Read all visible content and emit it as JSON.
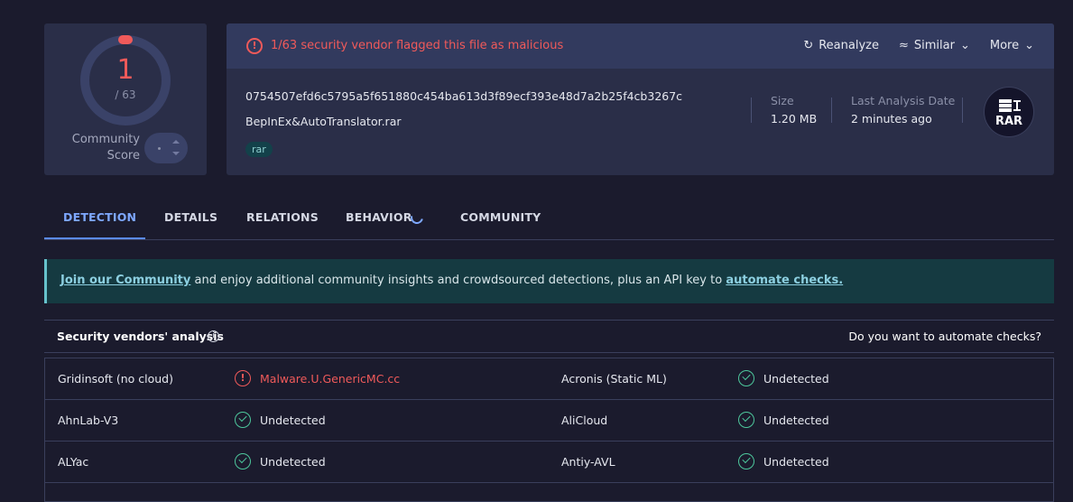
{
  "score": {
    "detections": "1",
    "total": "/ 63",
    "community_label_line1": "Community",
    "community_label_line2": "Score"
  },
  "file": {
    "alert": "1/63 security vendor flagged this file as malicious",
    "actions": {
      "reanalyze": "Reanalyze",
      "similar": "Similar",
      "more": "More"
    },
    "hash": "0754507efd6c5795a5f651880c454ba613d3f89ecf393e48d7a2b25f4cb3267c",
    "name": "BepInEx&AutoTranslator.rar",
    "tag": "rar",
    "size_label": "Size",
    "size_value": "1.20 MB",
    "last_label": "Last Analysis Date",
    "last_value": "2 minutes ago",
    "type_badge": "RAR"
  },
  "tabs": [
    {
      "label": "DETECTION"
    },
    {
      "label": "DETAILS"
    },
    {
      "label": "RELATIONS"
    },
    {
      "label": "BEHAVIOR"
    },
    {
      "label": "COMMUNITY"
    }
  ],
  "banner": {
    "link1": "Join our Community",
    "middle": " and enjoy additional community insights and crowdsourced detections, plus an API key to ",
    "link2": "automate checks."
  },
  "vendors": {
    "title": "Security vendors' analysis",
    "automate": "Do you want to automate checks?",
    "rows": [
      {
        "left_name": "Gridinsoft (no cloud)",
        "left_result": "Malware.U.GenericMC.cc",
        "right_name": "Acronis (Static ML)",
        "right_result": "Undetected"
      },
      {
        "left_name": "AhnLab-V3",
        "left_result": "Undetected",
        "right_name": "AliCloud",
        "right_result": "Undetected"
      },
      {
        "left_name": "ALYac",
        "left_result": "Undetected",
        "right_name": "Antiy-AVL",
        "right_result": "Undetected"
      }
    ]
  },
  "colors": {
    "malicious": "#f05a5a",
    "clean": "#4dc79c",
    "accent": "#7ea8ff"
  }
}
